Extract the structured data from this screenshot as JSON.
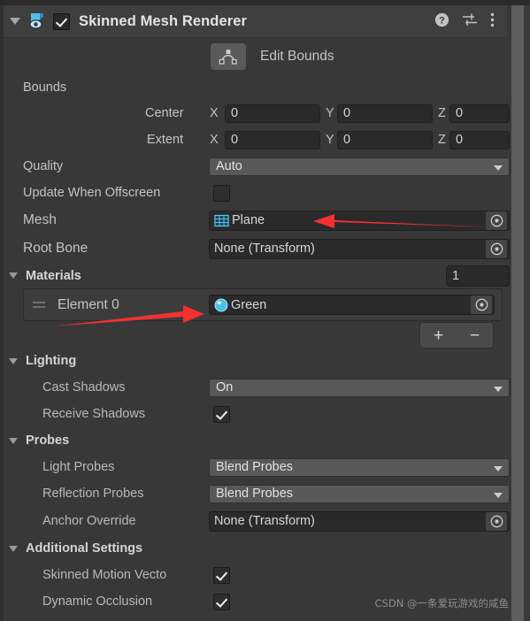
{
  "component": {
    "title": "Skinned Mesh Renderer",
    "enabled": true,
    "icon": "skinned-mesh-renderer-icon",
    "header_icons": [
      "help-icon",
      "preset-icon",
      "more-menu-icon"
    ]
  },
  "edit_bounds": {
    "label": "Edit Bounds",
    "icon": "edit-bounds-icon"
  },
  "bounds": {
    "label": "Bounds",
    "center": {
      "label": "Center",
      "x_label": "X",
      "y_label": "Y",
      "z_label": "Z",
      "x": "0",
      "y": "0",
      "z": "0"
    },
    "extent": {
      "label": "Extent",
      "x_label": "X",
      "y_label": "Y",
      "z_label": "Z",
      "x": "0",
      "y": "0",
      "z": "0"
    }
  },
  "quality": {
    "label": "Quality",
    "value": "Auto"
  },
  "update_when_offscreen": {
    "label": "Update When Offscreen",
    "checked": false
  },
  "mesh": {
    "label": "Mesh",
    "value": "Plane",
    "icon": "mesh-grid-icon"
  },
  "root_bone": {
    "label": "Root Bone",
    "value": "None (Transform)"
  },
  "materials": {
    "label": "Materials",
    "count": "1",
    "elements": [
      {
        "label": "Element 0",
        "value": "Green",
        "icon": "material-sphere-icon"
      }
    ],
    "add_label": "+",
    "remove_label": "−"
  },
  "lighting": {
    "label": "Lighting",
    "cast_shadows": {
      "label": "Cast Shadows",
      "value": "On"
    },
    "receive_shadows": {
      "label": "Receive Shadows",
      "checked": true
    }
  },
  "probes": {
    "label": "Probes",
    "light_probes": {
      "label": "Light Probes",
      "value": "Blend Probes"
    },
    "reflection_probes": {
      "label": "Reflection Probes",
      "value": "Blend Probes"
    },
    "anchor_override": {
      "label": "Anchor Override",
      "value": "None (Transform)"
    }
  },
  "additional_settings": {
    "label": "Additional Settings",
    "skinned_motion_vectors": {
      "label": "Skinned Motion Vecto",
      "checked": true
    },
    "dynamic_occlusion": {
      "label": "Dynamic Occlusion",
      "checked": true
    }
  },
  "watermark": "CSDN @一条爱玩游戏的咸鱼",
  "colors": {
    "background": "#383838",
    "header": "#3f3f3f",
    "field": "#2a2a2a",
    "popup": "#585858",
    "accent": "#4ec0e8",
    "arrow": "#f23030"
  }
}
